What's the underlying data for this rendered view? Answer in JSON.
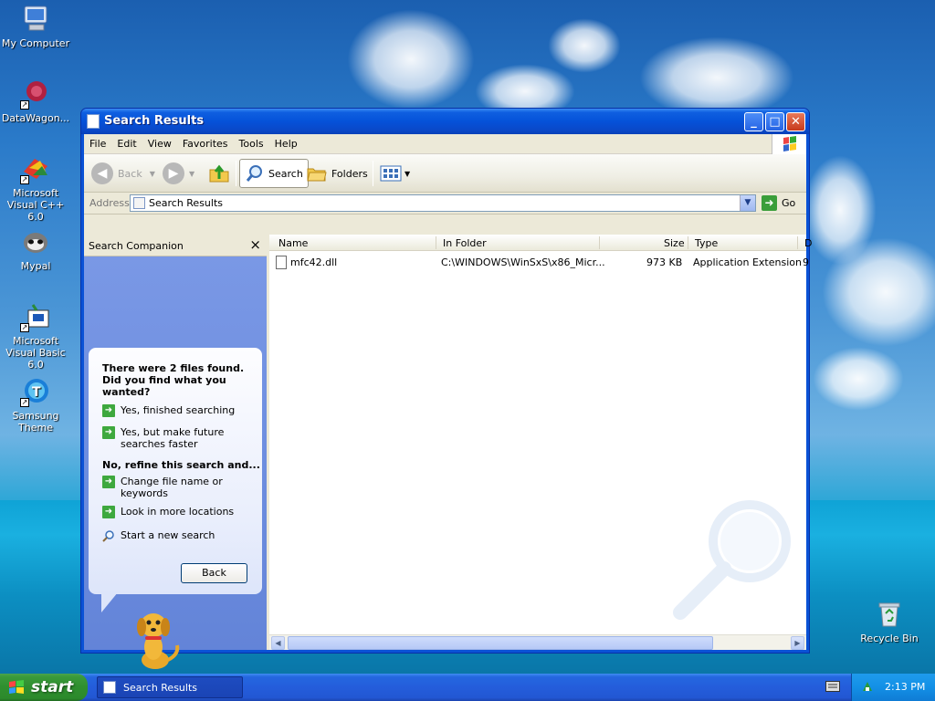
{
  "desktop": {
    "icons": [
      {
        "label": "My Computer"
      },
      {
        "label": "DataWagon..."
      },
      {
        "label": "Microsoft Visual C++ 6.0"
      },
      {
        "label": "Mypal"
      },
      {
        "label": "Microsoft Visual Basic 6.0"
      },
      {
        "label": "Samsung Theme"
      },
      {
        "label": "Recycle Bin"
      }
    ]
  },
  "window": {
    "title": "Search Results",
    "menu": [
      "File",
      "Edit",
      "View",
      "Favorites",
      "Tools",
      "Help"
    ],
    "toolbar": {
      "back_label": "Back",
      "search_label": "Search",
      "folders_label": "Folders"
    },
    "address": {
      "label": "Address",
      "value": "Search Results",
      "go_label": "Go"
    },
    "companion": {
      "title": "Search Companion",
      "heading": "There were 2 files found. Did you find what you wanted?",
      "options": [
        "Yes, finished searching",
        "Yes, but make future searches faster"
      ],
      "refine_heading": "No, refine this search and...",
      "refine_options": [
        "Change file name or keywords",
        "Look in more locations",
        "Start a new search"
      ],
      "back_button": "Back"
    },
    "columns": [
      "Name",
      "In Folder",
      "Size",
      "Type",
      "D"
    ],
    "rows": [
      {
        "name": "mfc42.dll",
        "folder": "C:\\WINDOWS\\WinSxS\\x86_Micr...",
        "size": "973 KB",
        "type": "Application Extension",
        "date": "9"
      }
    ]
  },
  "taskbar": {
    "start_label": "start",
    "task_item": "Search Results",
    "clock": "2:13 PM"
  },
  "colors": {
    "title_blue": "#0552d9",
    "start_green": "#2f8f2f",
    "pane_blue": "#6f8fe0"
  }
}
